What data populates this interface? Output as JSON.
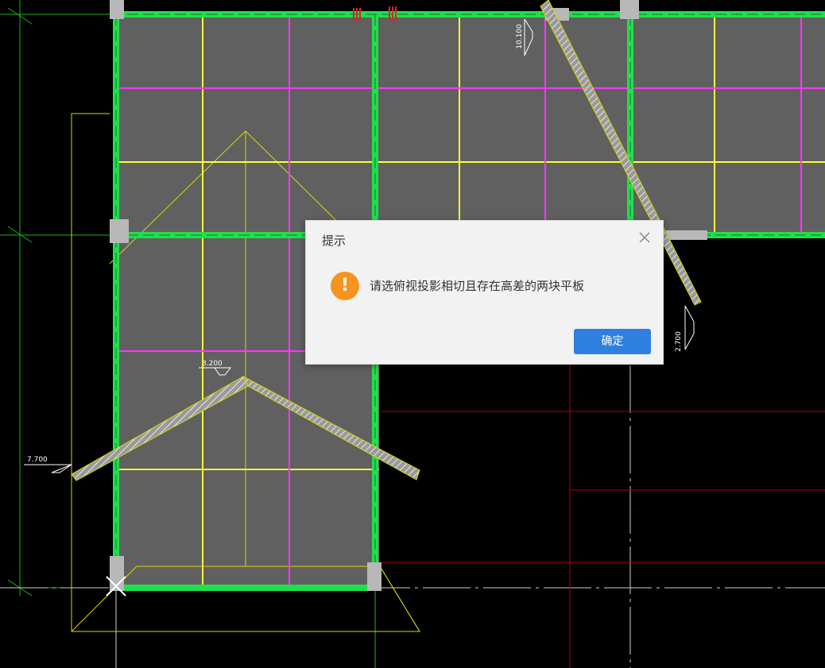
{
  "cad": {
    "level_labels": [
      "10.100",
      "2.700",
      "3.200",
      "7.700"
    ]
  },
  "dialog": {
    "title": "提示",
    "close_icon": "close-icon",
    "warning_icon": "warning-icon",
    "warning_symbol": "!",
    "message": "请选俯视投影相切且存在高差的两块平板",
    "ok_label": "确定"
  },
  "colors": {
    "background": "#000000",
    "slab_fill": "#606060",
    "beam_green": "#1fe04a",
    "grid_yellow": "#ffff33",
    "grid_magenta": "#ff33ff",
    "axis_red": "#cc0000",
    "dialog_bg": "#f2f2f2",
    "warning_orange": "#f7931e",
    "button_blue": "#2f7fe0"
  }
}
